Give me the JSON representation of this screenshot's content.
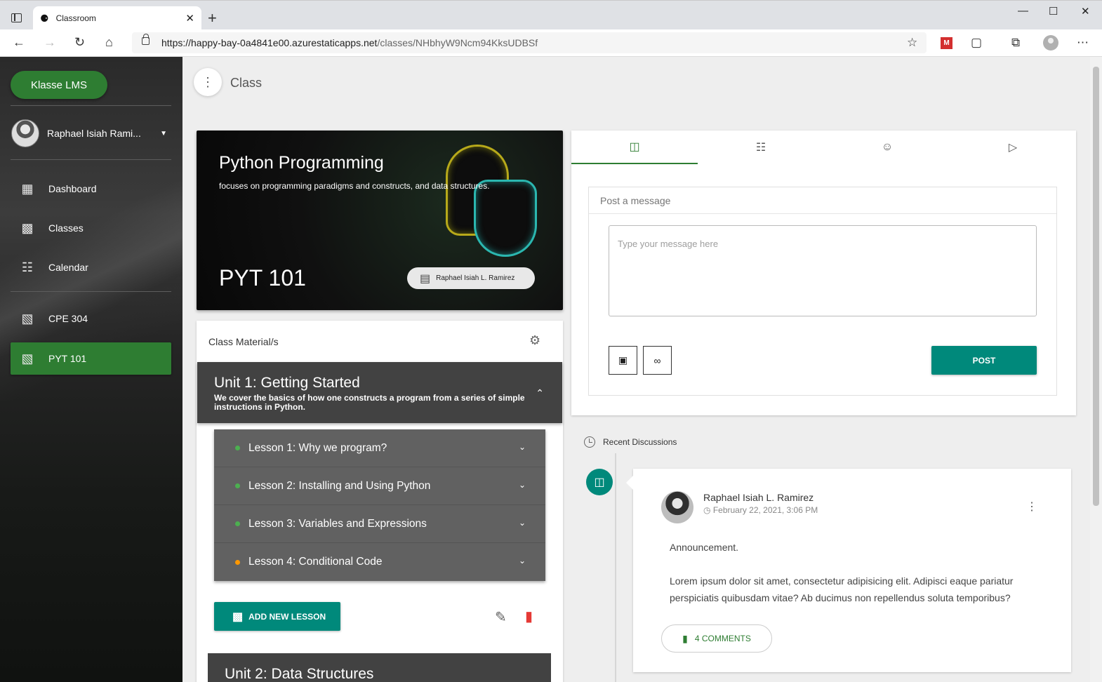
{
  "browser": {
    "tab_title": "Classroom",
    "url_host": "https://happy-bay-0a4841e00.azurestaticapps.net",
    "url_path": "/classes/NHbhyW9Ncm94KksUDBSf",
    "icons": [
      "back-icon",
      "forward-icon",
      "reload-icon",
      "home-icon",
      "lock-icon",
      "favorites-icon",
      "screenshot-icon",
      "collections-icon",
      "profile-icon",
      "more-icon"
    ]
  },
  "sidebar": {
    "brand": "Klasse LMS",
    "user_name": "Raphael Isiah Rami...",
    "items": [
      {
        "label": "Dashboard",
        "icon": "dashboard-icon"
      },
      {
        "label": "Classes",
        "icon": "classes-icon"
      },
      {
        "label": "Calendar",
        "icon": "calendar-icon"
      }
    ],
    "classes": [
      {
        "label": "CPE 304",
        "icon": "book-icon",
        "active": false
      },
      {
        "label": "PYT 101",
        "icon": "book-icon",
        "active": true
      }
    ],
    "active_color": "#2e7d32"
  },
  "header": {
    "title": "Class"
  },
  "hero": {
    "title": "Python Programming",
    "subtitle": "focuses on programming paradigms and constructs, and data structures.",
    "code": "PYT 101",
    "teacher": "Raphael Isiah L. Ramirez"
  },
  "materials": {
    "heading": "Class Material/s",
    "unit1": {
      "title": "Unit 1: Getting Started",
      "description": "We cover the basics of how one constructs a program from a series of simple instructions in Python."
    },
    "lessons": [
      {
        "label": "Lesson 1: Why we program?",
        "status_color": "#4caf50"
      },
      {
        "label": "Lesson 2: Installing and Using Python",
        "status_color": "#4caf50"
      },
      {
        "label": "Lesson 3: Variables and Expressions",
        "status_color": "#4caf50"
      },
      {
        "label": "Lesson 4: Conditional Code",
        "status_color": "#ff9800"
      }
    ],
    "add_lesson_label": "ADD NEW LESSON",
    "unit2": {
      "title": "Unit 2: Data Structures"
    }
  },
  "stream": {
    "tabs": [
      "stream-icon",
      "calendar-icon",
      "people-icon",
      "video-icon"
    ],
    "post_header": "Post a message",
    "message_placeholder": "Type your message here",
    "post_label": "POST",
    "accent": "#00897b"
  },
  "recent": {
    "heading": "Recent Discussions",
    "post": {
      "author": "Raphael Isiah L. Ramirez",
      "date": "February 22, 2021, 3:06 PM",
      "type": "Announcement.",
      "body": "Lorem ipsum dolor sit amet, consectetur adipisicing elit. Adipisci eaque pariatur perspiciatis quibusdam vitae? Ab ducimus non repellendus soluta temporibus?",
      "comments_label": "4 COMMENTS"
    }
  }
}
